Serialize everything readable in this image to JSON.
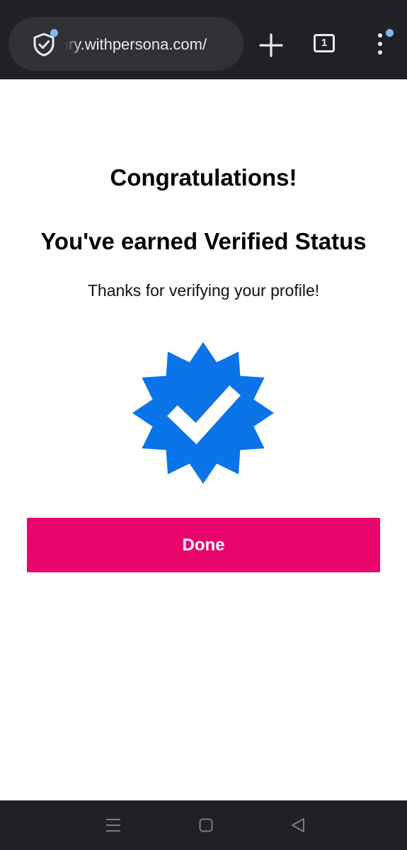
{
  "browser": {
    "url": "iry.withpersona.com/",
    "tab_count": "1",
    "icons": {
      "site_security": "shield-check-icon",
      "new_tab": "plus-icon",
      "tabs": "tab-switcher-icon",
      "menu": "more-vertical-icon"
    }
  },
  "page": {
    "title": "Congratulations!",
    "heading": "You've earned Verified Status",
    "message": "Thanks for verifying your profile!",
    "badge_icon": "verified-badge-icon",
    "done_label": "Done"
  },
  "system_nav": {
    "icons": [
      "menu-lines-icon",
      "home-square-icon",
      "back-triangle-icon"
    ]
  },
  "colors": {
    "accent": "#e8066d",
    "badge": "#0a74e8",
    "chrome_bg": "#202124",
    "notification_dot": "#8ab4f8"
  }
}
